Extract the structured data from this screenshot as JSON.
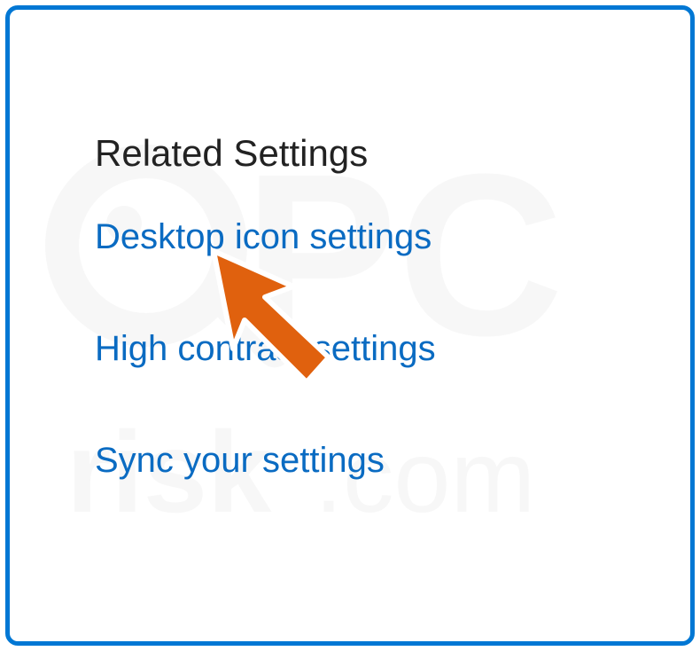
{
  "section": {
    "heading": "Related Settings",
    "links": [
      {
        "label": "Desktop icon settings"
      },
      {
        "label": "High contrast settings"
      },
      {
        "label": "Sync your settings"
      }
    ]
  },
  "watermark_text": "pcrisk.com"
}
